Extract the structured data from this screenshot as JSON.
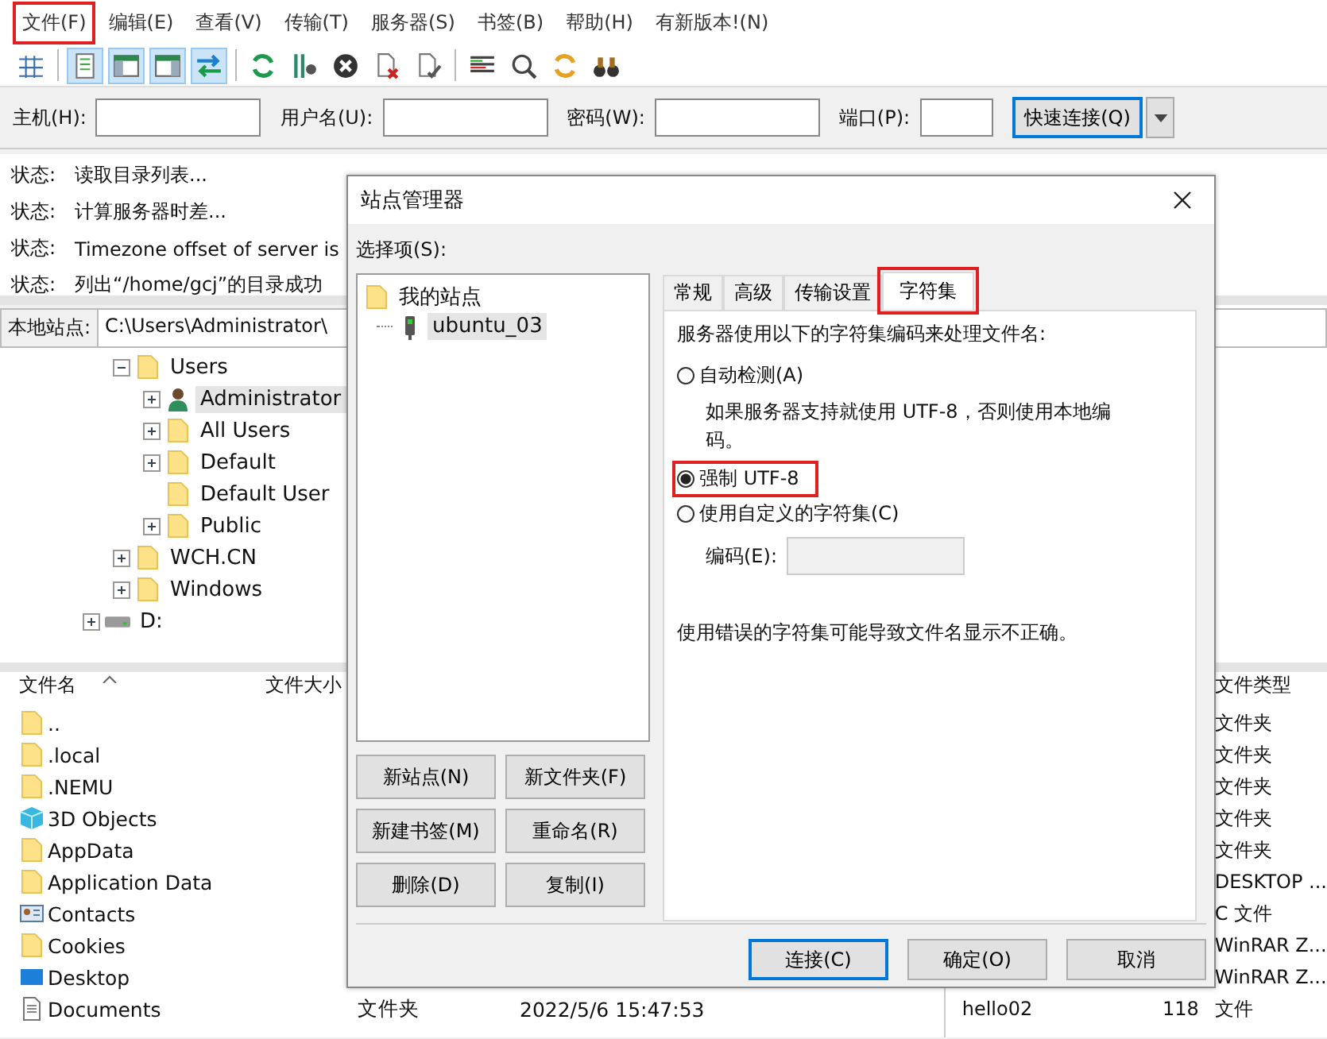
{
  "menu": [
    {
      "label": "文件(F)",
      "highlighted": true
    },
    {
      "label": "编辑(E)",
      "highlighted": false
    },
    {
      "label": "查看(V)",
      "highlighted": false
    },
    {
      "label": "传输(T)",
      "highlighted": false
    },
    {
      "label": "服务器(S)",
      "highlighted": false
    },
    {
      "label": "书签(B)",
      "highlighted": false
    },
    {
      "label": "帮助(H)",
      "highlighted": false
    },
    {
      "label": "有新版本!(N)",
      "highlighted": false
    }
  ],
  "toolbar": [
    {
      "pressed": false
    },
    {
      "pressed": true
    },
    {
      "pressed": true
    },
    {
      "pressed": true
    },
    {
      "pressed": true
    },
    {
      "pressed": false
    },
    {
      "pressed": false
    },
    {
      "pressed": false
    },
    {
      "pressed": false
    },
    {
      "pressed": false
    },
    {
      "pressed": false
    },
    {
      "pressed": false
    },
    {
      "pressed": false
    },
    {
      "pressed": false
    }
  ],
  "quickconnect": {
    "fields": [
      {
        "label": "主机(H):"
      },
      {
        "label": "用户名(U):"
      },
      {
        "label": "密码(W):"
      },
      {
        "label": "端口(P):"
      }
    ],
    "button": "快速连接(Q)"
  },
  "log": [
    {
      "prefix": "状态:",
      "text": "读取目录列表..."
    },
    {
      "prefix": "状态:",
      "text": "计算服务器时差..."
    },
    {
      "prefix": "状态:",
      "text": "Timezone offset of server is"
    },
    {
      "prefix": "状态:",
      "text": "列出“/home/gcj”的目录成功"
    }
  ],
  "local_site": {
    "label": "本地站点:",
    "path": "C:\\Users\\Administrator\\"
  },
  "local_tree": [
    {
      "kind": "hidden",
      "children": [
        {
          "label": "Users",
          "kind": "folder",
          "expanded": true,
          "selected": false,
          "children": [
            {
              "label": "Administrator",
              "kind": "user",
              "expanded": false,
              "selected": true
            },
            {
              "label": "All Users",
              "kind": "folder",
              "expanded": false,
              "selected": false
            },
            {
              "label": "Default",
              "kind": "folder",
              "expanded": false,
              "selected": false
            },
            {
              "label": "Default User",
              "kind": "leaf",
              "selected": false
            },
            {
              "label": "Public",
              "kind": "folder",
              "expanded": false,
              "selected": false
            }
          ]
        },
        {
          "label": "WCH.CN",
          "kind": "folder",
          "expanded": false,
          "selected": false
        },
        {
          "label": "Windows",
          "kind": "folder",
          "expanded": false,
          "selected": false
        }
      ]
    },
    {
      "label": "D:",
      "kind": "drive",
      "expanded": false,
      "selected": false
    }
  ],
  "local_files": {
    "columns": [
      "文件名",
      "文件大小"
    ],
    "rows": [
      {
        "name": "..",
        "kind": "folder"
      },
      {
        "name": ".local",
        "kind": "folder"
      },
      {
        "name": ".NEMU",
        "kind": "folder"
      },
      {
        "name": "3D Objects",
        "kind": "cube"
      },
      {
        "name": "AppData",
        "kind": "folder"
      },
      {
        "name": "Application Data",
        "kind": "folder"
      },
      {
        "name": "Contacts",
        "kind": "contacts"
      },
      {
        "name": "Cookies",
        "kind": "folder"
      },
      {
        "name": "Desktop",
        "kind": "desktop"
      },
      {
        "name": "Documents",
        "kind": "document",
        "type": "文件夹",
        "modified": "2022/5/6 15:47:53"
      }
    ]
  },
  "remote_files": {
    "columns": [
      "文件类型"
    ],
    "rows": [
      {
        "type": "文件夹"
      },
      {
        "type": "文件夹"
      },
      {
        "type": "文件夹"
      },
      {
        "type": "文件夹"
      },
      {
        "type": "文件夹"
      },
      {
        "type": "DESKTOP ..."
      },
      {
        "type": "C 文件"
      },
      {
        "type": "WinRAR Z..."
      },
      {
        "type": "WinRAR Z..."
      },
      {
        "name": "hello02",
        "size": "118",
        "type": "文件"
      }
    ]
  },
  "dialog": {
    "title": "站点管理器",
    "select_label": "选择项(S):",
    "sites": [
      {
        "label": "我的站点",
        "kind": "folder",
        "selected": false,
        "children": [
          {
            "label": "ubuntu_03",
            "kind": "server",
            "selected": true
          }
        ]
      }
    ],
    "site_buttons": [
      "新站点(N)",
      "新文件夹(F)",
      "新建书签(M)",
      "重命名(R)",
      "删除(D)",
      "复制(I)"
    ],
    "tabs": [
      {
        "label": "常规",
        "selected": false,
        "highlighted": false
      },
      {
        "label": "高级",
        "selected": false,
        "highlighted": false
      },
      {
        "label": "传输设置",
        "selected": false,
        "highlighted": false
      },
      {
        "label": "字符集",
        "selected": true,
        "highlighted": true
      }
    ],
    "intro": "服务器使用以下的字符集编码来处理文件名:",
    "options": [
      {
        "label": "自动检测(A)",
        "selected": false,
        "highlighted": false,
        "description": "如果服务器支持就使用 UTF-8，否则使用本地编码。"
      },
      {
        "label": "强制 UTF-8",
        "selected": true,
        "highlighted": true
      },
      {
        "label": "使用自定义的字符集(C)",
        "selected": false,
        "highlighted": false,
        "field_label": "编码(E):",
        "field_disabled": true
      }
    ],
    "warning": "使用错误的字符集可能导致文件名显示不正确。",
    "buttons": [
      {
        "label": "连接(C)",
        "focused": true
      },
      {
        "label": "确定(O)",
        "focused": false
      },
      {
        "label": "取消",
        "focused": false
      }
    ]
  }
}
